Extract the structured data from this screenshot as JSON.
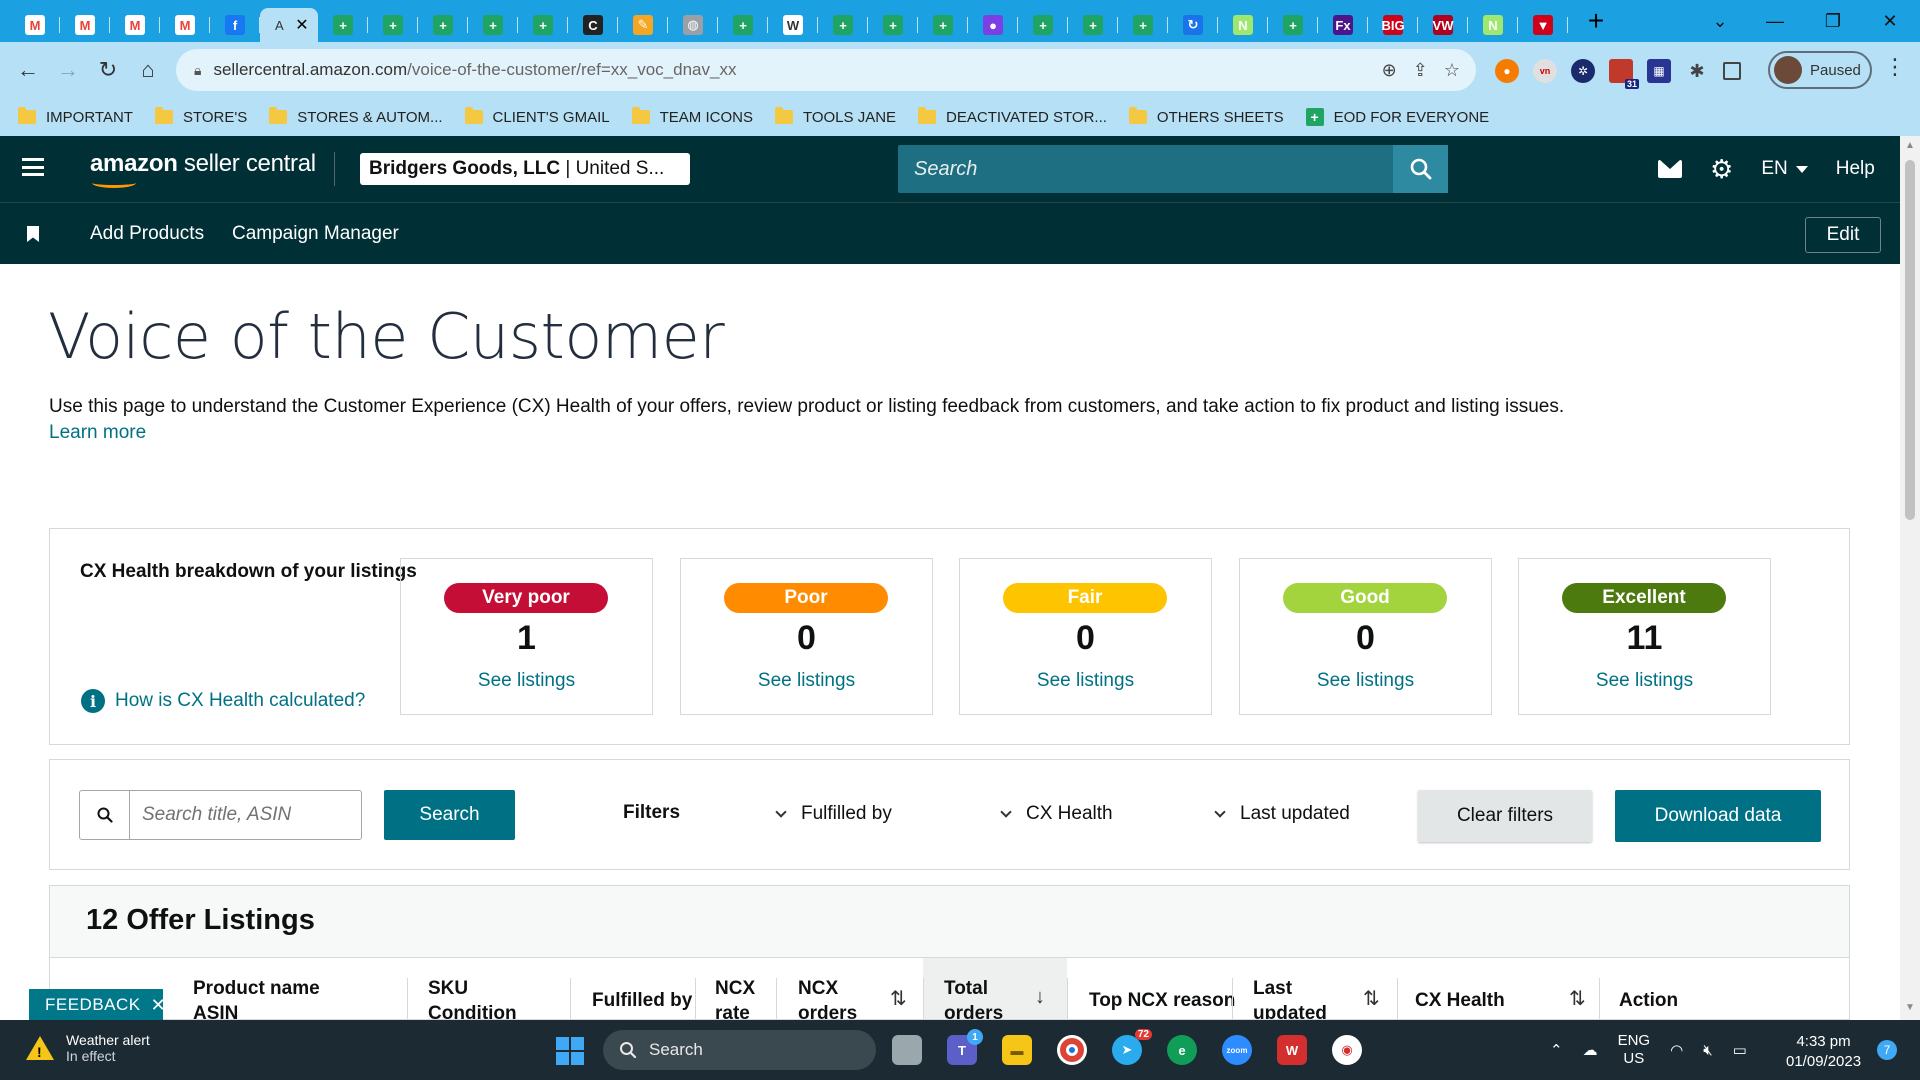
{
  "browser": {
    "tabs": [
      {
        "icon": "gmail-icon",
        "label": "M",
        "color": "#ea4335"
      },
      {
        "icon": "gmail-icon",
        "label": "M",
        "color": "#ea4335"
      },
      {
        "icon": "gmail-icon",
        "label": "M",
        "color": "#ea4335"
      },
      {
        "icon": "gmail-icon",
        "label": "M",
        "color": "#ea4335"
      },
      {
        "icon": "facebook-icon",
        "label": "f",
        "color": "#1877f2"
      },
      {
        "icon": "amazon-icon",
        "label": "A",
        "color": "#b6e0f5",
        "active": true
      },
      {
        "icon": "sheets-icon",
        "label": "+",
        "color": "#1fa463"
      },
      {
        "icon": "sheets-icon",
        "label": "+",
        "color": "#1fa463"
      },
      {
        "icon": "sheets-icon",
        "label": "+",
        "color": "#1fa463"
      },
      {
        "icon": "sheets-icon",
        "label": "+",
        "color": "#1fa463"
      },
      {
        "icon": "sheets-icon",
        "label": "+",
        "color": "#1fa463"
      },
      {
        "icon": "circle-c-icon",
        "label": "C",
        "color": "#222222"
      },
      {
        "icon": "pencil-icon",
        "label": "✎",
        "color": "#f5a623"
      },
      {
        "icon": "globe-icon",
        "label": "◍",
        "color": "#9aa0a6"
      },
      {
        "icon": "sheets-icon",
        "label": "+",
        "color": "#1fa463"
      },
      {
        "icon": "doc-icon",
        "label": "W",
        "color": "#ffffff"
      },
      {
        "icon": "sheets-icon",
        "label": "+",
        "color": "#1fa463"
      },
      {
        "icon": "sheets-icon",
        "label": "+",
        "color": "#1fa463"
      },
      {
        "icon": "sheets-icon",
        "label": "+",
        "color": "#1fa463"
      },
      {
        "icon": "chat-icon",
        "label": "●",
        "color": "#7b3fe4"
      },
      {
        "icon": "sheets-icon",
        "label": "+",
        "color": "#1fa463"
      },
      {
        "icon": "sheets-icon",
        "label": "+",
        "color": "#1fa463"
      },
      {
        "icon": "sheets-icon",
        "label": "+",
        "color": "#1fa463"
      },
      {
        "icon": "refresh-icon",
        "label": "↻",
        "color": "#1a73e8"
      },
      {
        "icon": "wise-icon",
        "label": "N",
        "color": "#9fe870"
      },
      {
        "icon": "sheets-icon",
        "label": "+",
        "color": "#1fa463"
      },
      {
        "icon": "fedex-icon",
        "label": "Fx",
        "color": "#4d148c"
      },
      {
        "icon": "big-icon",
        "label": "BIG",
        "color": "#d0021b"
      },
      {
        "icon": "vw-icon",
        "label": "VW",
        "color": "#b00020"
      },
      {
        "icon": "wise-icon",
        "label": "N",
        "color": "#9fe870"
      },
      {
        "icon": "shield-tab-icon",
        "label": "▼",
        "color": "#d0021b"
      }
    ],
    "url_host": "sellercentral.amazon.com",
    "url_path": "/voice-of-the-customer/ref=xx_voc_dnav_xx",
    "profile_status": "Paused",
    "calendar_badge": "31",
    "bookmarks": [
      {
        "label": "IMPORTANT",
        "type": "folder"
      },
      {
        "label": "STORE'S",
        "type": "folder"
      },
      {
        "label": "STORES & AUTOM...",
        "type": "folder"
      },
      {
        "label": "CLIENT'S GMAIL",
        "type": "folder"
      },
      {
        "label": "TEAM ICONS",
        "type": "folder"
      },
      {
        "label": "TOOLS JANE",
        "type": "folder"
      },
      {
        "label": "DEACTIVATED STOR...",
        "type": "folder"
      },
      {
        "label": "OTHERS SHEETS",
        "type": "folder"
      },
      {
        "label": "EOD FOR EVERYONE",
        "type": "sheet"
      }
    ]
  },
  "header": {
    "logo_bold": "amazon",
    "logo_rest": " seller central",
    "account_bold": "Bridgers Goods, LLC",
    "account_rest": " | United S...",
    "search_placeholder": "Search",
    "lang": "EN",
    "help": "Help"
  },
  "nav": {
    "links": [
      "Add Products",
      "Campaign Manager"
    ],
    "edit": "Edit"
  },
  "page": {
    "title": "Voice of the Customer",
    "description": "Use this page to understand the Customer Experience (CX) Health of your offers, review product or listing feedback from customers, and take action to fix product and listing issues.",
    "learn_more": "Learn more"
  },
  "cx_health": {
    "heading": "CX Health breakdown of your listings",
    "help_link": "How is CX Health calculated?",
    "cards": [
      {
        "label": "Very poor",
        "count": "1",
        "link": "See listings",
        "color": "#c40e35"
      },
      {
        "label": "Poor",
        "count": "0",
        "link": "See listings",
        "color": "#ff8c00"
      },
      {
        "label": "Fair",
        "count": "0",
        "link": "See listings",
        "color": "#ffc400"
      },
      {
        "label": "Good",
        "count": "0",
        "link": "See listings",
        "color": "#a3d43e"
      },
      {
        "label": "Excellent",
        "count": "11",
        "link": "See listings",
        "color": "#4d7a0f"
      }
    ]
  },
  "filters": {
    "search_placeholder": "Search title, ASIN",
    "search_button": "Search",
    "label": "Filters",
    "dropdowns": [
      "Fulfilled by",
      "CX Health",
      "Last updated"
    ],
    "clear": "Clear filters",
    "download": "Download data"
  },
  "listings": {
    "title": "12 Offer Listings",
    "columns": [
      {
        "line1": "Product name",
        "line2": "ASIN"
      },
      {
        "line1": "SKU",
        "line2": "Condition"
      },
      {
        "line1": "Fulfilled by",
        "line2": ""
      },
      {
        "line1": "NCX",
        "line2": "rate"
      },
      {
        "line1": "NCX",
        "line2": "orders"
      },
      {
        "line1": "Total",
        "line2": "orders"
      },
      {
        "line1": "Top NCX reason",
        "line2": ""
      },
      {
        "line1": "Last",
        "line2": "updated"
      },
      {
        "line1": "CX Health",
        "line2": ""
      },
      {
        "line1": "Action",
        "line2": ""
      }
    ]
  },
  "feedback": "FEEDBACK",
  "taskbar": {
    "weather_title": "Weather alert",
    "weather_sub": "In effect",
    "search": "Search",
    "telegram_badge": "72",
    "teams_badge": "1",
    "lang_line1": "ENG",
    "lang_line2": "US",
    "time": "4:33 pm",
    "date": "01/09/2023",
    "notifications": "7"
  }
}
